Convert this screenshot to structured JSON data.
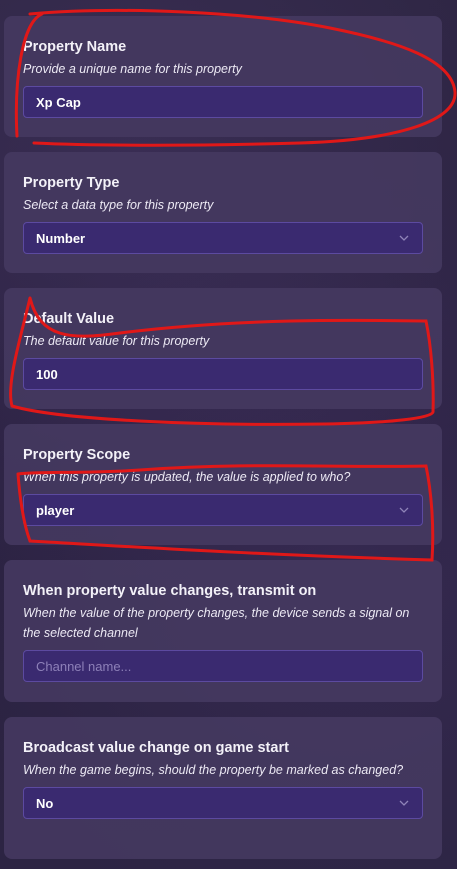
{
  "panel": {
    "property_name": {
      "title": "Property Name",
      "description": "Provide a unique name for this property",
      "value": "Xp Cap"
    },
    "property_type": {
      "title": "Property Type",
      "description": "Select a data type for this property",
      "selected": "Number"
    },
    "default_value": {
      "title": "Default Value",
      "description": "The default value for this property",
      "value": "100"
    },
    "property_scope": {
      "title": "Property Scope",
      "description": "When this property is updated, the value is applied to who?",
      "selected": "player"
    },
    "transmit_on": {
      "title": "When property value changes, transmit on",
      "description": "When the value of the property changes, the device sends a signal on the selected channel",
      "placeholder": "Channel name..."
    },
    "broadcast_on_start": {
      "title": "Broadcast value change on game start",
      "description": "When the game begins, should the property be marked as changed?",
      "selected": "No"
    }
  },
  "colors": {
    "card_background": "#44385f",
    "field_background": "#3a2a70",
    "field_border": "#5c4aa0",
    "annotation_red": "#e01818"
  }
}
